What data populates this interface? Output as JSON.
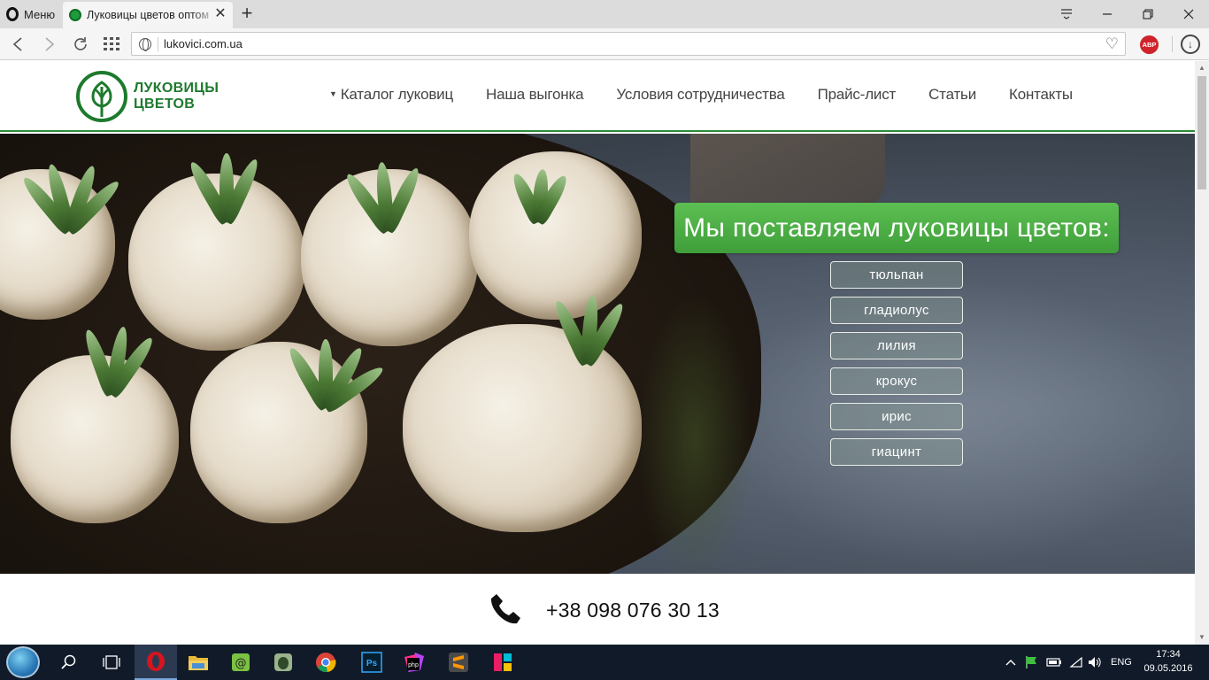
{
  "browser": {
    "menu_label": "Меню",
    "tab_title": "Луковицы цветов оптом",
    "url": "lukovici.com.ua",
    "abp_label": "ABP"
  },
  "site": {
    "logo": {
      "line1": "ЛУКОВИЦЫ",
      "line2": "ЦВЕТОВ"
    },
    "nav": [
      {
        "label": "Каталог луковиц",
        "dropdown": true
      },
      {
        "label": "Наша выгонка"
      },
      {
        "label": "Условия сотрудничества"
      },
      {
        "label": "Прайс-лист"
      },
      {
        "label": "Статьи"
      },
      {
        "label": "Контакты"
      }
    ],
    "hero": {
      "title": "Мы поставляем луковицы цветов:",
      "flowers": [
        "тюльпан",
        "гладиолус",
        "лилия",
        "крокус",
        "ирис",
        "гиацинт"
      ]
    },
    "phone": "+38 098 076 30 13",
    "colors": {
      "brand_green": "#2c8a3a",
      "banner_green": "#4caf47",
      "text_dark": "#444444"
    }
  },
  "taskbar": {
    "apps": [
      "search-icon",
      "task-view-icon",
      "opera-icon",
      "file-explorer-icon",
      "mail-agent-icon",
      "evernote-icon",
      "chrome-icon",
      "photoshop-icon",
      "phpstorm-icon",
      "sublime-text-icon",
      "app-icon"
    ],
    "ps_label": "Ps",
    "php_label": "php",
    "lang": "ENG",
    "time": "17:34",
    "date": "09.05.2016"
  }
}
